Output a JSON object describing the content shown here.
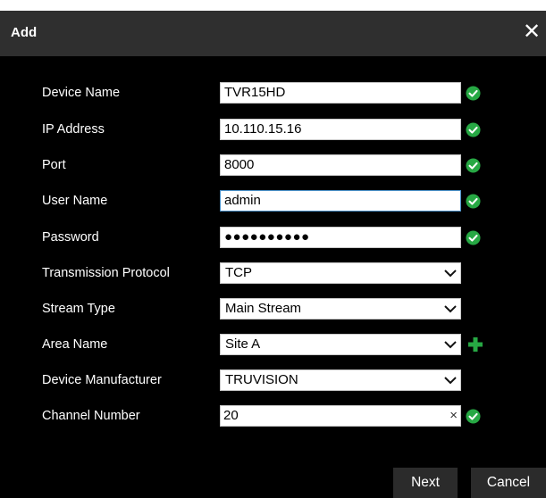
{
  "dialog": {
    "title": "Add",
    "close_glyph": "✕"
  },
  "fields": {
    "device_name": {
      "label": "Device Name",
      "value": "TVR15HD",
      "status_icon": "check-circle"
    },
    "ip_address": {
      "label": "IP Address",
      "value": "10.110.15.16",
      "status_icon": "check-circle"
    },
    "port": {
      "label": "Port",
      "value": "8000",
      "status_icon": "check-circle"
    },
    "user_name": {
      "label": "User Name",
      "value": "admin",
      "status_icon": "check-circle"
    },
    "password": {
      "label": "Password",
      "value": "●●●●●●●●●●",
      "status_icon": "check-circle"
    },
    "transmission_protocol": {
      "label": "Transmission Protocol",
      "value": "TCP"
    },
    "stream_type": {
      "label": "Stream Type",
      "value": "Main Stream"
    },
    "area_name": {
      "label": "Area Name",
      "value": "Site A",
      "action_icon": "plus"
    },
    "device_manufacturer": {
      "label": "Device Manufacturer",
      "value": "TRUVISION"
    },
    "channel_number": {
      "label": "Channel Number",
      "value": "20",
      "clear_glyph": "×",
      "status_icon": "check-circle"
    }
  },
  "buttons": {
    "next": "Next",
    "cancel": "Cancel"
  },
  "colors": {
    "dialog_bg": "#000000",
    "titlebar_bg": "#2f2f2f",
    "success_green": "#27a844",
    "button_bg": "#2b2b2b"
  }
}
